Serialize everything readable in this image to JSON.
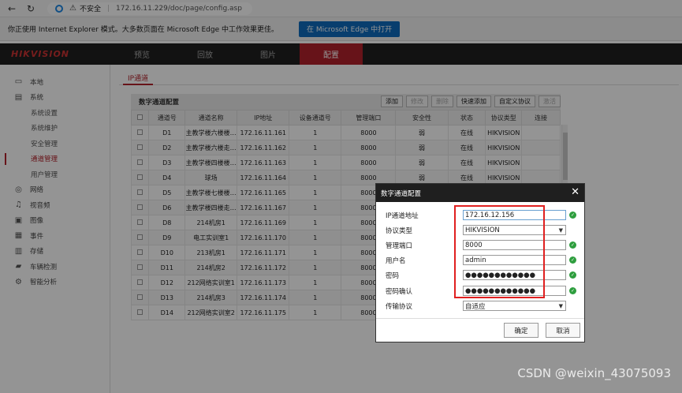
{
  "browser": {
    "security_label": "不安全",
    "url": "172.16.11.229/doc/page/config.asp"
  },
  "ie_banner": {
    "message": "你正使用 Internet Explorer 模式。大多数页面在 Microsoft Edge 中工作效果更佳。",
    "button": "在 Microsoft Edge 中打开"
  },
  "header": {
    "logo": "HIKVISION",
    "nav": [
      "预览",
      "回放",
      "图片",
      "配置"
    ],
    "active_nav": "配置"
  },
  "sidebar": {
    "items": [
      {
        "label": "本地",
        "icon": "monitor-icon",
        "level": 0
      },
      {
        "label": "系统",
        "icon": "system-icon",
        "level": 0
      },
      {
        "label": "系统设置",
        "level": 1
      },
      {
        "label": "系统维护",
        "level": 1
      },
      {
        "label": "安全管理",
        "level": 1
      },
      {
        "label": "通道管理",
        "level": 1,
        "active": true
      },
      {
        "label": "用户管理",
        "level": 1
      },
      {
        "label": "网络",
        "icon": "globe-icon",
        "level": 0
      },
      {
        "label": "视音频",
        "icon": "audio-video-icon",
        "level": 0
      },
      {
        "label": "图像",
        "icon": "image-icon",
        "level": 0
      },
      {
        "label": "事件",
        "icon": "event-icon",
        "level": 0
      },
      {
        "label": "存储",
        "icon": "storage-icon",
        "level": 0
      },
      {
        "label": "车辆检测",
        "icon": "car-icon",
        "level": 0
      },
      {
        "label": "智能分析",
        "icon": "analysis-icon",
        "level": 0
      }
    ]
  },
  "main": {
    "tab": "IP通道",
    "toolbar_title": "数字通道配置",
    "buttons": [
      {
        "label": "添加",
        "disabled": false
      },
      {
        "label": "修改",
        "disabled": true
      },
      {
        "label": "删除",
        "disabled": true
      },
      {
        "label": "快速添加",
        "disabled": false
      },
      {
        "label": "自定义协议",
        "disabled": false
      },
      {
        "label": "激活",
        "disabled": true
      }
    ],
    "columns": [
      "通道号",
      "通道名称",
      "IP地址",
      "设备通道号",
      "管理端口",
      "安全性",
      "状态",
      "协议类型",
      "连接"
    ],
    "rows": [
      [
        "D1",
        "主教学楼六楼楼…",
        "172.16.11.161",
        "1",
        "8000",
        "弱",
        "在线",
        "HIKVISION",
        ""
      ],
      [
        "D2",
        "主教学楼六楼走…",
        "172.16.11.162",
        "1",
        "8000",
        "弱",
        "在线",
        "HIKVISION",
        ""
      ],
      [
        "D3",
        "主教学楼四楼楼…",
        "172.16.11.163",
        "1",
        "8000",
        "弱",
        "在线",
        "HIKVISION",
        ""
      ],
      [
        "D4",
        "球场",
        "172.16.11.164",
        "1",
        "8000",
        "弱",
        "在线",
        "HIKVISION",
        ""
      ],
      [
        "D5",
        "主教学楼七楼楼…",
        "172.16.11.165",
        "1",
        "8000",
        "",
        "",
        "",
        ""
      ],
      [
        "D6",
        "主教学楼四楼走…",
        "172.16.11.167",
        "1",
        "8000",
        "",
        "",
        "",
        ""
      ],
      [
        "D8",
        "214机房1",
        "172.16.11.169",
        "1",
        "8000",
        "",
        "",
        "",
        ""
      ],
      [
        "D9",
        "电工实训室1",
        "172.16.11.170",
        "1",
        "8000",
        "",
        "",
        "",
        ""
      ],
      [
        "D10",
        "213机房1",
        "172.16.11.171",
        "1",
        "8000",
        "",
        "",
        "",
        ""
      ],
      [
        "D11",
        "214机房2",
        "172.16.11.172",
        "1",
        "8000",
        "",
        "",
        "",
        ""
      ],
      [
        "D12",
        "212网络实训室1",
        "172.16.11.173",
        "1",
        "8000",
        "",
        "",
        "",
        ""
      ],
      [
        "D13",
        "214机房3",
        "172.16.11.174",
        "1",
        "8000",
        "",
        "",
        "",
        ""
      ],
      [
        "D14",
        "212网络实训室2",
        "172.16.11.175",
        "1",
        "8000",
        "",
        "",
        "",
        ""
      ]
    ]
  },
  "dialog": {
    "title": "数字通道配置",
    "fields": {
      "ip_label": "IP通道地址",
      "ip_value": "172.16.12.156",
      "protocol_label": "协议类型",
      "protocol_value": "HIKVISION",
      "port_label": "管理端口",
      "port_value": "8000",
      "user_label": "用户名",
      "user_value": "admin",
      "password_label": "密码",
      "password_value": "●●●●●●●●●●●●",
      "confirm_label": "密码确认",
      "confirm_value": "●●●●●●●●●●●●",
      "transport_label": "传输协议",
      "transport_value": "自适应"
    },
    "ok": "确定",
    "cancel": "取消"
  },
  "watermark": "CSDN @weixin_43075093"
}
